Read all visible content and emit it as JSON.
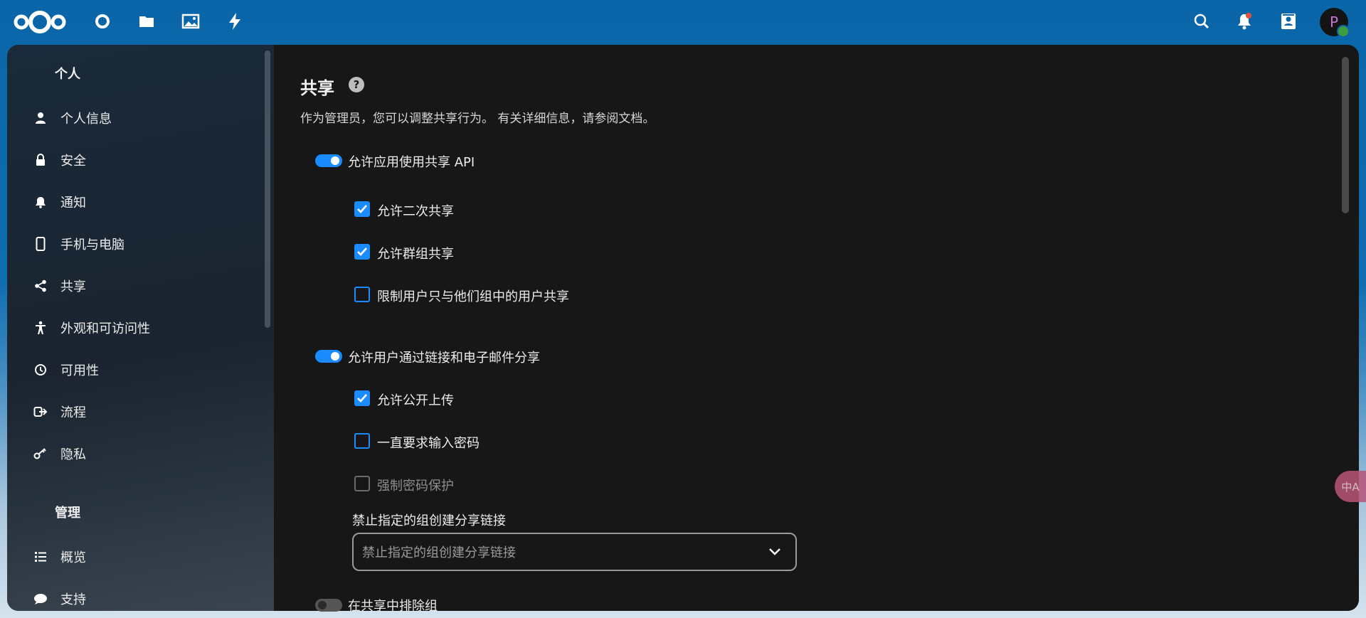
{
  "header": {
    "apps": [
      "dashboard-icon",
      "files-icon",
      "photos-icon",
      "activity-icon"
    ],
    "right_icons": [
      "search-icon",
      "bell-icon",
      "contacts-icon"
    ],
    "avatar_letter": "P",
    "avatar_status_color": "#3d9d3d"
  },
  "sidebar": {
    "personal_heading": "个人",
    "personal_items": [
      {
        "label": "个人信息",
        "icon": "user-icon"
      },
      {
        "label": "安全",
        "icon": "lock-icon"
      },
      {
        "label": "通知",
        "icon": "bell-icon"
      },
      {
        "label": "手机与电脑",
        "icon": "phone-icon"
      },
      {
        "label": "共享",
        "icon": "share-icon"
      },
      {
        "label": "外观和可访问性",
        "icon": "accessibility-icon"
      },
      {
        "label": "可用性",
        "icon": "clock-icon"
      },
      {
        "label": "流程",
        "icon": "flow-icon"
      },
      {
        "label": "隐私",
        "icon": "key-icon"
      }
    ],
    "admin_heading": "管理",
    "admin_items": [
      {
        "label": "概览",
        "icon": "list-icon"
      },
      {
        "label": "支持",
        "icon": "chat-icon"
      }
    ]
  },
  "main": {
    "title": "共享",
    "description": "作为管理员，您可以调整共享行为。 有关详细信息，请参阅文档。",
    "allow_api": {
      "label": "允许应用使用共享 API",
      "enabled": true
    },
    "allow_reshare": {
      "label": "允许二次共享",
      "checked": true
    },
    "allow_group_share": {
      "label": "允许群组共享",
      "checked": true
    },
    "restrict_group": {
      "label": "限制用户只与他们组中的用户共享",
      "checked": false
    },
    "allow_links": {
      "label": "允许用户通过链接和电子邮件分享",
      "enabled": true
    },
    "allow_public_upload": {
      "label": "允许公开上传",
      "checked": true
    },
    "always_password": {
      "label": "一直要求输入密码",
      "checked": false
    },
    "enforce_password": {
      "label": "强制密码保护",
      "checked": false
    },
    "deny_groups": {
      "label": "禁止指定的组创建分享链接",
      "placeholder": "禁止指定的组创建分享链接"
    },
    "exclude_groups": {
      "label": "在共享中排除组",
      "enabled": false
    }
  },
  "colors": {
    "accent": "#1a8cff",
    "background": "#171717"
  },
  "translate_badge": "中A"
}
